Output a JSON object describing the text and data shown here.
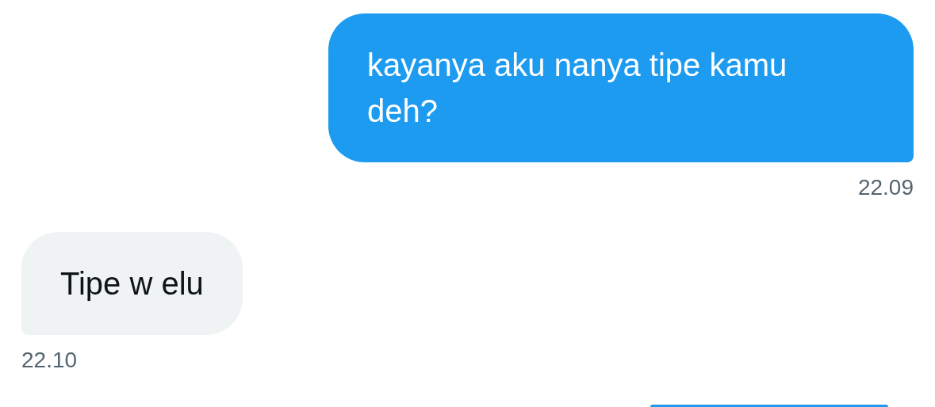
{
  "messages": [
    {
      "kind": "sent",
      "text": "kayanya aku nanya tipe kamu deh?",
      "time": "22.09"
    },
    {
      "kind": "received",
      "text": "Tipe w elu",
      "time": "22.10"
    },
    {
      "kind": "sent"
    }
  ]
}
